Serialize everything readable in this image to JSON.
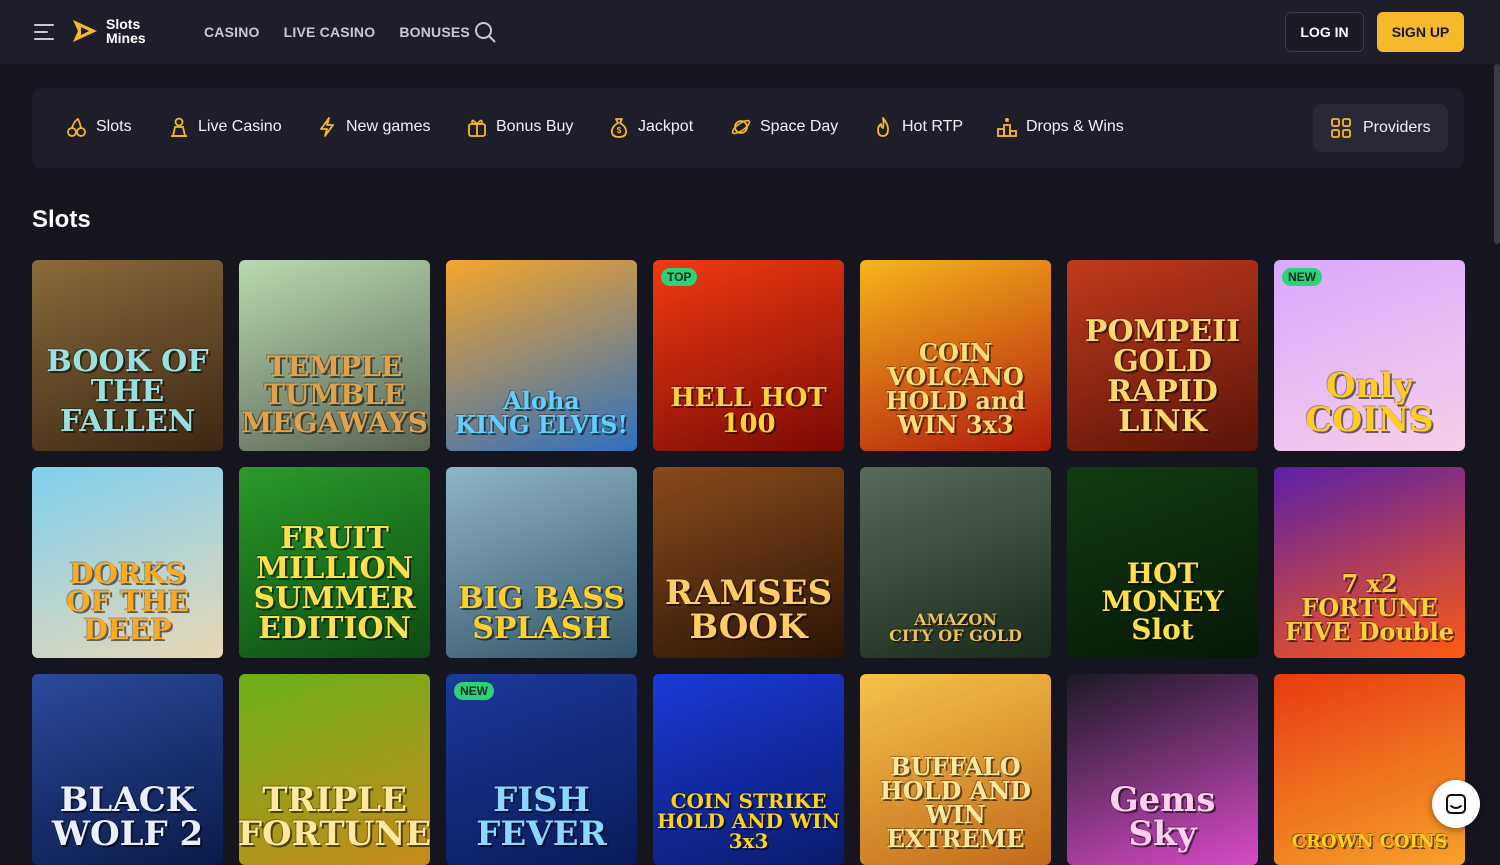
{
  "header": {
    "logo_line1": "Slots",
    "logo_line2": "Mines",
    "nav": [
      "CASINO",
      "LIVE CASINO",
      "BONUSES"
    ],
    "login_label": "LOG IN",
    "signup_label": "SIGN UP"
  },
  "categories": {
    "items": [
      {
        "label": "Slots",
        "icon": "cherries-icon"
      },
      {
        "label": "Live Casino",
        "icon": "dealer-icon"
      },
      {
        "label": "New games",
        "icon": "lightning-icon"
      },
      {
        "label": "Bonus Buy",
        "icon": "gift-icon"
      },
      {
        "label": "Jackpot",
        "icon": "money-bag-icon"
      },
      {
        "label": "Space Day",
        "icon": "planet-icon"
      },
      {
        "label": "Hot RTP",
        "icon": "flame-icon"
      },
      {
        "label": "Drops & Wins",
        "icon": "podium-icon"
      }
    ],
    "providers_label": "Providers"
  },
  "section": {
    "title": "Slots"
  },
  "games": [
    {
      "title": "BOOK OF\nTHE FALLEN",
      "badge": "",
      "colors": [
        "#8a6a3a",
        "#3b2714"
      ],
      "text_color": "#9be0e0"
    },
    {
      "title": "TEMPLE\nTUMBLE\nMEGAWAYS",
      "badge": "",
      "colors": [
        "#b9d9b0",
        "#5a6455"
      ],
      "text_color": "#e0a24a"
    },
    {
      "title": "Aloha\nKING ELVIS!",
      "badge": "",
      "colors": [
        "#f6a52b",
        "#2e6fbf"
      ],
      "text_color": "#5fd0ff"
    },
    {
      "title": "HELL HOT\n100",
      "badge": "TOP",
      "colors": [
        "#f03a12",
        "#7a0a04"
      ],
      "text_color": "#ffd23a"
    },
    {
      "title": "COIN\nVOLCANO\nHOLD and WIN 3x3",
      "badge": "",
      "colors": [
        "#f6b51c",
        "#b21a0c"
      ],
      "text_color": "#ffe07a"
    },
    {
      "title": "POMPEII\nGOLD\nRAPID LINK",
      "badge": "",
      "colors": [
        "#c23a1c",
        "#5a1408"
      ],
      "text_color": "#ffd96a"
    },
    {
      "title": "Only\nCOINS",
      "badge": "NEW",
      "colors": [
        "#d8a8ff",
        "#f6d0e8"
      ],
      "text_color": "#ffcc22"
    },
    {
      "title": "DORKS\nOF THE\nDEEP",
      "badge": "",
      "colors": [
        "#7fd0ef",
        "#e8d7b6"
      ],
      "text_color": "#ffa91e"
    },
    {
      "title": "FRUIT\nMILLION\nSUMMER EDITION",
      "badge": "",
      "colors": [
        "#2a9a2a",
        "#0d4a12"
      ],
      "text_color": "#ffe04a"
    },
    {
      "title": "BIG BASS\nSPLASH",
      "badge": "",
      "colors": [
        "#8fb6c6",
        "#33566a"
      ],
      "text_color": "#ffcf2a"
    },
    {
      "title": "RAMSES\nBOOK",
      "badge": "",
      "colors": [
        "#8a4a1a",
        "#2a1406"
      ],
      "text_color": "#ffcc66"
    },
    {
      "title": "AMAZON\nCITY OF GOLD",
      "badge": "",
      "colors": [
        "#5a6a5a",
        "#1a2a1a"
      ],
      "text_color": "#e8c25a"
    },
    {
      "title": "HOT\nMONEY\nSlot",
      "badge": "",
      "colors": [
        "#123a12",
        "#061806"
      ],
      "text_color": "#ffe04a"
    },
    {
      "title": "7 x2\nFORTUNE\nFIVE Double",
      "badge": "",
      "colors": [
        "#5a1fa8",
        "#ff5a12"
      ],
      "text_color": "#ffd23a"
    },
    {
      "title": "BLACK\nWOLF 2",
      "badge": "",
      "colors": [
        "#2a4a9a",
        "#0a1a4a"
      ],
      "text_color": "#e8f0ff"
    },
    {
      "title": "TRIPLE\nFORTUNE",
      "badge": "",
      "colors": [
        "#6ab01a",
        "#c8891a"
      ],
      "text_color": "#ffe8a0"
    },
    {
      "title": "FISH\nFEVER",
      "badge": "NEW",
      "colors": [
        "#1a3a9a",
        "#0a1a5a"
      ],
      "text_color": "#8ad8ff"
    },
    {
      "title": "COIN STRIKE\nHOLD AND WIN 3x3",
      "badge": "",
      "colors": [
        "#1a3ad8",
        "#0a1a6a"
      ],
      "text_color": "#ffd21a"
    },
    {
      "title": "BUFFALO\nHOLD AND WIN\nEXTREME",
      "badge": "",
      "colors": [
        "#f6c24a",
        "#c26a1a"
      ],
      "text_color": "#ffe8a0"
    },
    {
      "title": "Gems\nSky",
      "badge": "",
      "colors": [
        "#1a1a24",
        "#d84ac8"
      ],
      "text_color": "#ffd0f0"
    },
    {
      "title": "CROWN COINS",
      "badge": "",
      "colors": [
        "#e83a12",
        "#f6a22a"
      ],
      "text_color": "#ffd21a"
    }
  ]
}
